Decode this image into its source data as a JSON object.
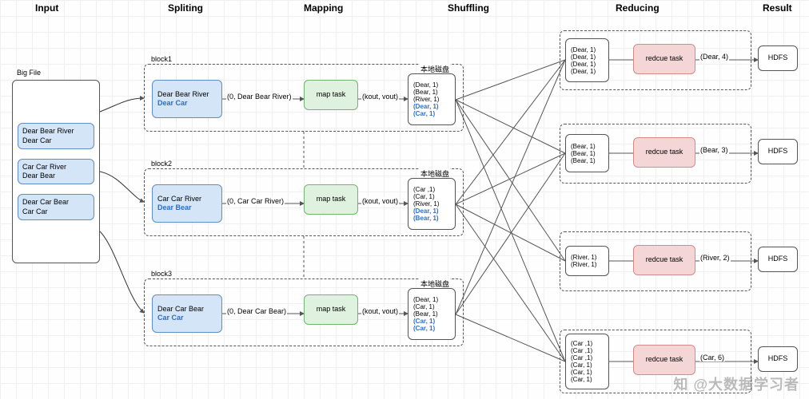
{
  "stages": {
    "input": "Input",
    "splitting": "Spliting",
    "mapping": "Mapping",
    "shuffling": "Shuffling",
    "reducing": "Reducing",
    "result": "Result"
  },
  "bigfile": {
    "label": "Big File",
    "slices": [
      "Dear Bear River\nDear Car",
      "Car Car River\nDear Bear",
      "Dear Car Bear\nCar Car"
    ]
  },
  "blocks": [
    {
      "name": "block1",
      "split_line1": "Dear Bear River",
      "split_line2": "Dear Car",
      "map_in": "(0, Dear Bear River)",
      "map_task": "map task",
      "map_out": "(kout, vout)",
      "disk_label": "本地磁盘",
      "emitted_black": [
        "(Dear, 1)",
        "(Bear, 1)",
        "(River, 1)"
      ],
      "emitted_accent": [
        "(Dear, 1)",
        "(Car, 1)"
      ]
    },
    {
      "name": "block2",
      "split_line1": "Car Car River",
      "split_line2": "Dear Bear",
      "map_in": "(0, Car Car River)",
      "map_task": "map task",
      "map_out": "(kout, vout)",
      "disk_label": "本地磁盘",
      "emitted_black": [
        "(Car ,1)",
        "(Car, 1)",
        "(River, 1)"
      ],
      "emitted_accent": [
        "(Dear, 1)",
        "(Bear, 1)"
      ]
    },
    {
      "name": "block3",
      "split_line1": "Dear Car Bear",
      "split_line2": "Car Car",
      "map_in": "(0, Dear Car Bear)",
      "map_task": "map task",
      "map_out": "(kout, vout)",
      "disk_label": "本地磁盘",
      "emitted_black": [
        "(Dear, 1)",
        "(Car, 1)",
        "(Bear, 1)"
      ],
      "emitted_accent": [
        "(Car, 1)",
        "(Car, 1)"
      ]
    }
  ],
  "reducers": [
    {
      "inputs": [
        "(Dear, 1)",
        "(Dear, 1)",
        "(Dear, 1)",
        "(Dear, 1)"
      ],
      "task": "redcue task",
      "out": "(Dear, 4)",
      "result": "HDFS"
    },
    {
      "inputs": [
        "(Bear, 1)",
        "(Bear, 1)",
        "(Bear, 1)"
      ],
      "task": "redcue task",
      "out": "(Bear, 3)",
      "result": "HDFS"
    },
    {
      "inputs": [
        "(River, 1)",
        "(River, 1)"
      ],
      "task": "redcue task",
      "out": "(River, 2)",
      "result": "HDFS"
    },
    {
      "inputs": [
        "(Car ,1)",
        "(Car ,1)",
        "(Car ,1)",
        "(Car, 1)",
        "(Car, 1)",
        "(Car, 1)"
      ],
      "task": "redcue task",
      "out": "(Car, 6)",
      "result": "HDFS"
    }
  ],
  "watermark": "知 @大数据学习者",
  "chart_data": {
    "type": "diagram",
    "title": "MapReduce word-count flow",
    "stages": [
      "Input",
      "Spliting",
      "Mapping",
      "Shuffling",
      "Reducing",
      "Result"
    ],
    "input_text": "Dear Bear River\nDear Car\nCar Car River\nDear Bear\nDear Car Bear\nCar Car",
    "splits": [
      "Dear Bear River\nDear Car",
      "Car Car River\nDear Bear",
      "Dear Car Bear\nCar Car"
    ],
    "map_outputs": [
      [
        [
          "Dear",
          1
        ],
        [
          "Bear",
          1
        ],
        [
          "River",
          1
        ],
        [
          "Dear",
          1
        ],
        [
          "Car",
          1
        ]
      ],
      [
        [
          "Car",
          1
        ],
        [
          "Car",
          1
        ],
        [
          "River",
          1
        ],
        [
          "Dear",
          1
        ],
        [
          "Bear",
          1
        ]
      ],
      [
        [
          "Dear",
          1
        ],
        [
          "Car",
          1
        ],
        [
          "Bear",
          1
        ],
        [
          "Car",
          1
        ],
        [
          "Car",
          1
        ]
      ]
    ],
    "reduce_inputs": {
      "Dear": [
        1,
        1,
        1,
        1
      ],
      "Bear": [
        1,
        1,
        1
      ],
      "River": [
        1,
        1
      ],
      "Car": [
        1,
        1,
        1,
        1,
        1,
        1
      ]
    },
    "reduce_outputs": {
      "Dear": 4,
      "Bear": 3,
      "River": 2,
      "Car": 6
    },
    "result_sink": "HDFS"
  }
}
